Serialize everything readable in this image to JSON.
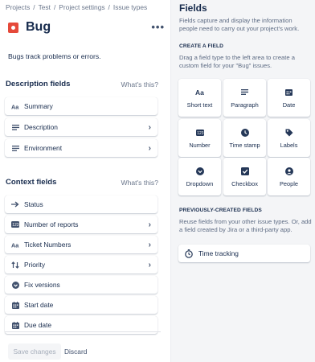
{
  "breadcrumb": [
    "Projects",
    "Test",
    "Project settings",
    "Issue types"
  ],
  "issue_type": {
    "title": "Bug",
    "more_label": "•••",
    "description": "Bugs track problems or errors."
  },
  "description_fields": {
    "heading": "Description fields",
    "whats_this": "What's this?",
    "items": [
      {
        "label": "Summary",
        "icon": "text-icon",
        "has_chevron": false
      },
      {
        "label": "Description",
        "icon": "paragraph-icon",
        "has_chevron": true
      },
      {
        "label": "Environment",
        "icon": "paragraph-icon",
        "has_chevron": true
      }
    ]
  },
  "context_fields": {
    "heading": "Context fields",
    "whats_this": "What's this?",
    "items": [
      {
        "label": "Status",
        "icon": "arrow-right-icon",
        "has_chevron": false
      },
      {
        "label": "Number of reports",
        "icon": "number-icon",
        "has_chevron": true
      },
      {
        "label": "Ticket Numbers",
        "icon": "text-icon",
        "has_chevron": true
      },
      {
        "label": "Priority",
        "icon": "priority-icon",
        "has_chevron": true
      },
      {
        "label": "Fix versions",
        "icon": "dropdown-icon",
        "has_chevron": false
      },
      {
        "label": "Start date",
        "icon": "calendar-icon",
        "has_chevron": false
      },
      {
        "label": "Due date",
        "icon": "calendar-icon",
        "has_chevron": false
      }
    ]
  },
  "footer": {
    "save_label": "Save changes",
    "discard_label": "Discard"
  },
  "fields_panel": {
    "title": "Fields",
    "intro": "Fields capture and display the information people need to carry out your project's work.",
    "create_heading": "CREATE A FIELD",
    "create_hint": "Drag a field type to the left area to create a custom field for your \"Bug\" issues.",
    "types": [
      {
        "label": "Short text",
        "icon": "text-icon"
      },
      {
        "label": "Paragraph",
        "icon": "paragraph-icon"
      },
      {
        "label": "Date",
        "icon": "calendar-icon"
      },
      {
        "label": "Number",
        "icon": "number-icon"
      },
      {
        "label": "Time stamp",
        "icon": "clock-icon"
      },
      {
        "label": "Labels",
        "icon": "tag-icon"
      },
      {
        "label": "Dropdown",
        "icon": "dropdown-icon"
      },
      {
        "label": "Checkbox",
        "icon": "checkbox-icon"
      },
      {
        "label": "People",
        "icon": "person-icon"
      }
    ],
    "previous_heading": "PREVIOUSLY-CREATED FIELDS",
    "previous_hint": "Reuse fields from your other issue types. Or, add a field created by Jira or a third-party app.",
    "previous_items": [
      {
        "label": "Time tracking",
        "icon": "stopwatch-icon"
      }
    ]
  },
  "colors": {
    "bug_red": "#E5493A",
    "text_primary": "#172B4D",
    "text_subtle": "#6B778C",
    "panel_bg": "#F4F5F7"
  }
}
